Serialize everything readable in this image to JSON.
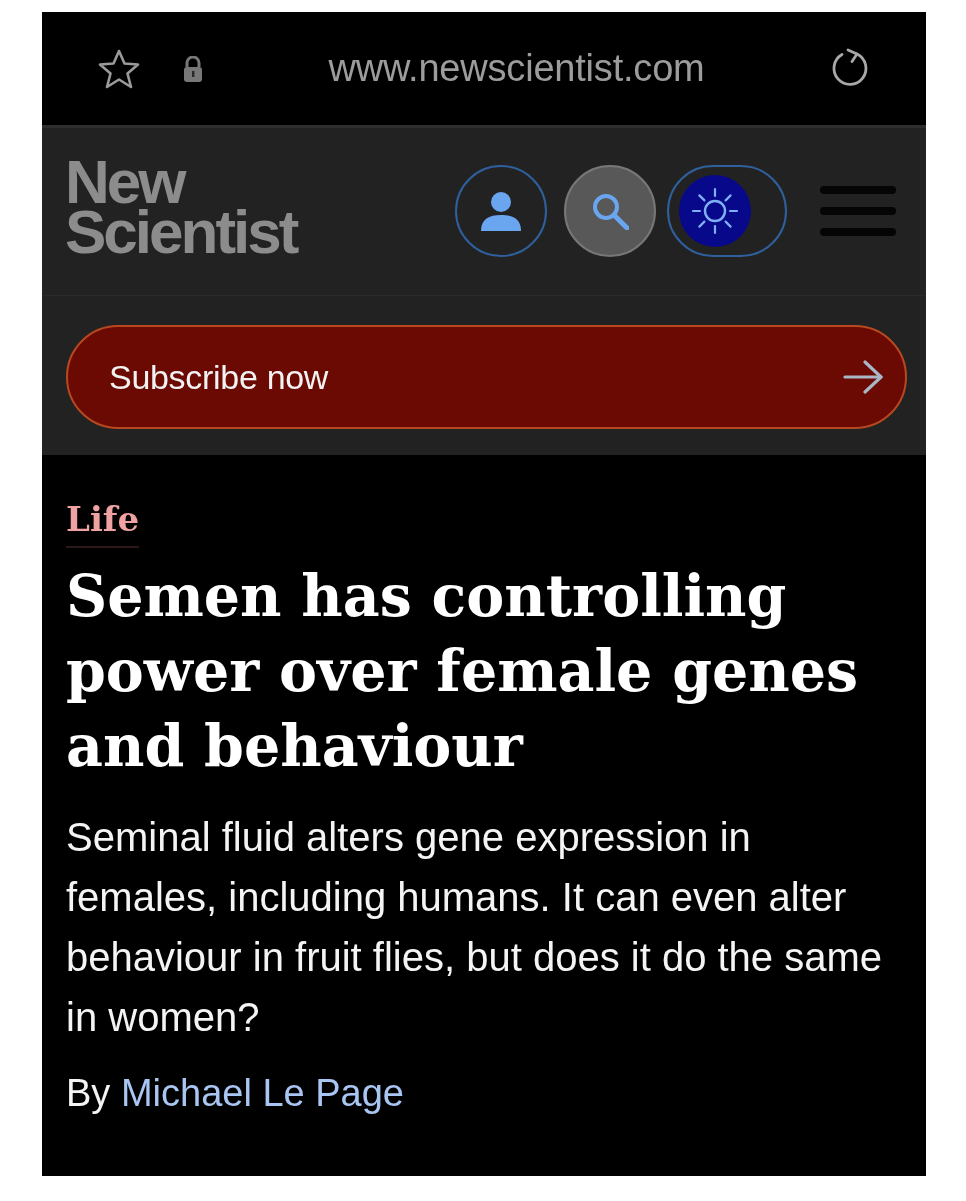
{
  "browser_bar": {
    "url": "www.newscientist.com"
  },
  "header": {
    "logo": [
      "New",
      "Scientist"
    ]
  },
  "subscribe_button": {
    "label": "Subscribe now"
  },
  "article": {
    "section": "Life",
    "headline": "Semen has controlling power over female genes and behaviour",
    "standfirst": "Seminal fluid alters gene expression in females, including humans. It can even alter behaviour in fruit flies, but does it do the same in women?",
    "byline": {
      "prefix": "By",
      "author": "Michael Le Page"
    }
  }
}
